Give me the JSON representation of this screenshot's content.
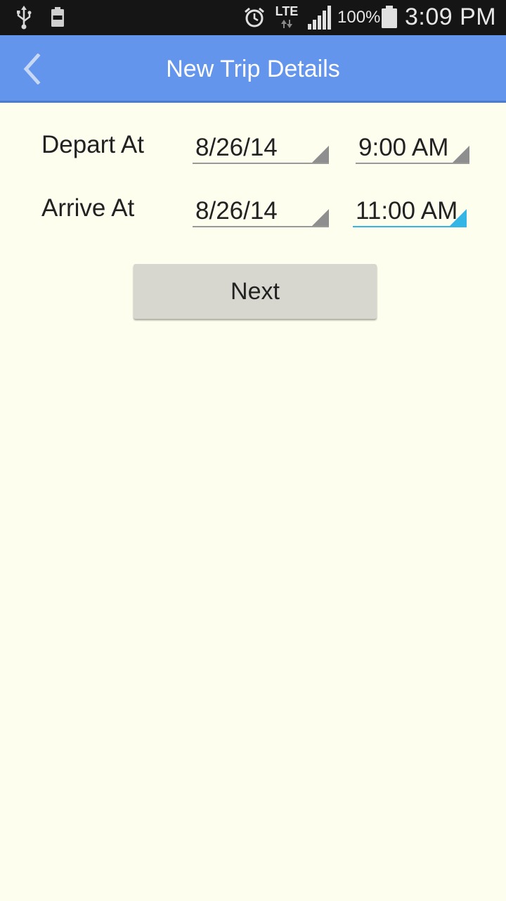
{
  "status_bar": {
    "lte_label": "LTE",
    "battery_percent": "100%",
    "time": "3:09 PM",
    "icons": [
      "usb-icon",
      "battery-small-icon",
      "alarm-icon",
      "lte-icon",
      "signal-icon",
      "battery-icon"
    ]
  },
  "app_bar": {
    "title": "New Trip Details",
    "background_color": "#6495ed",
    "back_icon": "chevron-left-icon"
  },
  "form": {
    "depart": {
      "label": "Depart At",
      "date": "8/26/14",
      "time": "9:00 AM"
    },
    "arrive": {
      "label": "Arrive At",
      "date": "8/26/14",
      "time": "11:00 AM"
    },
    "focus_color": "#33b5e5"
  },
  "actions": {
    "next_label": "Next"
  }
}
